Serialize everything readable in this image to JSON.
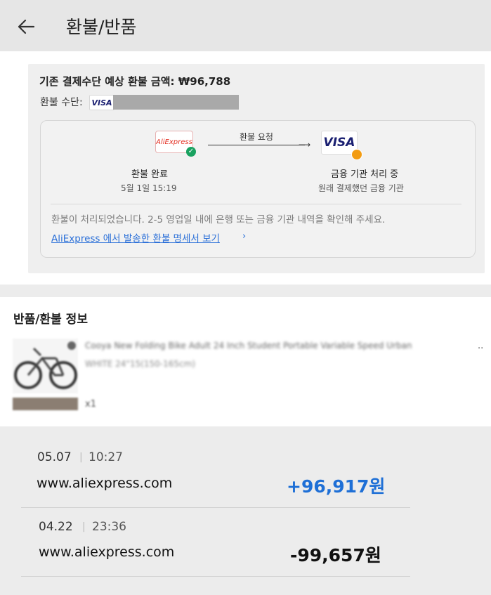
{
  "header": {
    "title": "환불/반품"
  },
  "refund": {
    "amount_text": "기존 결제수단 예상 환불 금액: ₩96,788",
    "method_label": "환불 수단:",
    "method_brand": "VISA",
    "request_label": "환불 요청",
    "left_logo": "AliExpress",
    "right_logo": "VISA",
    "left_step": {
      "title": "환불 완료",
      "date": "5월 1일 15:19"
    },
    "right_step": {
      "title": "금융 기관 처리 중",
      "subtitle": "원래 결제했던 금융 기관"
    },
    "notice": "환불이 처리되었습니다. 2-5 영업일 내에 은행 또는 금융 기관 내역을 확인해 주세요.",
    "receipt_link": "AliExpress 에서 발송한 환불 명세서 보기",
    "receipt_chevron": "›"
  },
  "info": {
    "title": "반품/환불 정보",
    "product_name": "Cooya New Folding Bike Adult 24 Inch Student Portable Variable Speed Urban",
    "product_ellipsis": "..",
    "product_option": "WHITE 24\"15(150-165cm)",
    "product_qty": "x1"
  },
  "transactions": [
    {
      "date": "05.07",
      "time": "10:27",
      "merchant": "www.aliexpress.com",
      "amount": "+96,917원",
      "color": "#1e6fd6"
    },
    {
      "date": "04.22",
      "time": "23:36",
      "merchant": "www.aliexpress.com",
      "amount": "-99,657원",
      "color": "#111111"
    }
  ]
}
